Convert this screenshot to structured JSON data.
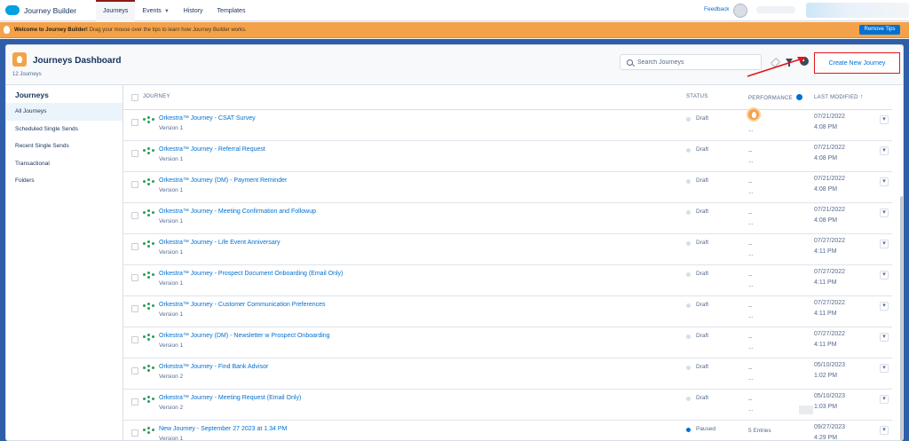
{
  "app": {
    "brand": "Journey Builder"
  },
  "nav": [
    {
      "label": "Journeys",
      "active": true
    },
    {
      "label": "Events",
      "dropdown": true
    },
    {
      "label": "History"
    },
    {
      "label": "Templates"
    }
  ],
  "topbar": {
    "feedback": "Feedback"
  },
  "tips": {
    "bold": "Welcome to Journey Builder!",
    "text": " Drag your mouse over the tips to learn how Journey Builder works.",
    "button": "Remove Tips"
  },
  "header": {
    "title": "Journeys Dashboard",
    "count": "12 Journeys",
    "search_placeholder": "Search Journeys",
    "create_button": "Create New Journey"
  },
  "sidebar": {
    "title": "Journeys",
    "items": [
      {
        "label": "All Journeys",
        "active": true
      },
      {
        "label": "Scheduled Single Sends"
      },
      {
        "label": "Recent Single Sends"
      },
      {
        "label": "Transactional"
      },
      {
        "label": "Folders"
      }
    ]
  },
  "columns": {
    "journey": "JOURNEY",
    "status": "STATUS",
    "performance": "PERFORMANCE",
    "last_modified": "LAST MODIFIED",
    "sort": "↑"
  },
  "rows": [
    {
      "name": "Orkestra™ Journey - CSAT Survey",
      "version": "Version 1",
      "status": "Draft",
      "perf1": "",
      "perf2": "...",
      "date": "07/21/2022",
      "time": "4:08 PM",
      "badge": true
    },
    {
      "name": "Orkestra™ Journey - Referral Request",
      "version": "Version 1",
      "status": "Draft",
      "perf1": "--",
      "perf2": "...",
      "date": "07/21/2022",
      "time": "4:08 PM"
    },
    {
      "name": "Orkestra™ Journey (DM) - Payment Reminder",
      "version": "Version 1",
      "status": "Draft",
      "perf1": "--",
      "perf2": "...",
      "date": "07/21/2022",
      "time": "4:08 PM"
    },
    {
      "name": "Orkestra™ Journey - Meeting Confirmation and Followup",
      "version": "Version 1",
      "status": "Draft",
      "perf1": "--",
      "perf2": "...",
      "date": "07/21/2022",
      "time": "4:08 PM"
    },
    {
      "name": "Orkestra™ Journey - Life Event Anniversary",
      "version": "Version 1",
      "status": "Draft",
      "perf1": "--",
      "perf2": "...",
      "date": "07/27/2022",
      "time": "4:11 PM"
    },
    {
      "name": "Orkestra™ Journey - Prospect Document Onboarding (Email Only)",
      "version": "Version 1",
      "status": "Draft",
      "perf1": "--",
      "perf2": "...",
      "date": "07/27/2022",
      "time": "4:11 PM"
    },
    {
      "name": "Orkestra™ Journey - Customer Communication Preferences",
      "version": "Version 1",
      "status": "Draft",
      "perf1": "--",
      "perf2": "...",
      "date": "07/27/2022",
      "time": "4:11 PM"
    },
    {
      "name": "Orkestra™ Journey (DM) - Newsletter w Prospect Onboarding",
      "version": "Version 1",
      "status": "Draft",
      "perf1": "--",
      "perf2": "...",
      "date": "07/27/2022",
      "time": "4:11 PM"
    },
    {
      "name": "Orkestra™ Journey - Find Bank Advisor",
      "version": "Version 2",
      "status": "Draft",
      "perf1": "--",
      "perf2": "...",
      "date": "05/10/2023",
      "time": "1:02 PM"
    },
    {
      "name": "Orkestra™ Journey - Meeting Request (Email Only)",
      "version": "Version 2",
      "status": "Draft",
      "perf1": "--",
      "perf2": "...",
      "date": "05/10/2023",
      "time": "1:03 PM"
    },
    {
      "name": "New Journey - September 27 2023 at 1.34 PM",
      "version": "Version 1",
      "status": "Paused",
      "perf1": "5 Entries",
      "perf2": "...",
      "date": "09/27/2023",
      "time": "4:29 PM",
      "paused": true
    }
  ],
  "row_menu_glyph": "▾",
  "colors": {
    "accent": "#0070d2",
    "tips": "#f4a24a",
    "highlight": "#e3161b"
  }
}
